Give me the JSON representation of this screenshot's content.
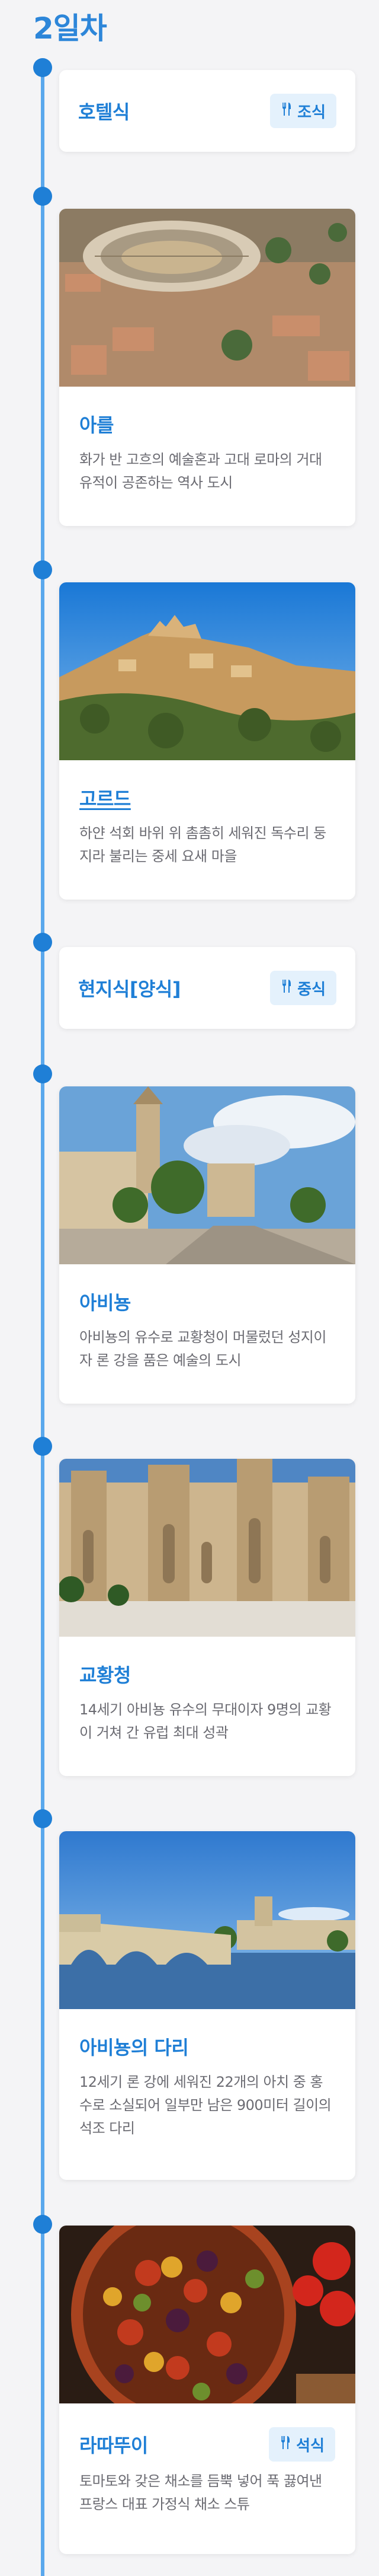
{
  "day": {
    "title": "2일차"
  },
  "items": [
    {
      "title": "호텔식",
      "meal": "조식"
    },
    {
      "title": "아를",
      "desc": "화가 반 고흐의 예술혼과 고대 로마의 거대 유적이 공존하는 역사 도시"
    },
    {
      "title": "고르드",
      "desc": "하얀 석회 바위 위 촘촘히 세워진 독수리 둥지라 불리는 중세 요새 마을"
    },
    {
      "title": "현지식[양식]",
      "meal": "중식"
    },
    {
      "title": "아비뇽",
      "desc": "아비뇽의 유수로 교황청이 머물렀던 성지이자 론 강을 품은 예술의 도시"
    },
    {
      "title": "교황청",
      "desc": "14세기 아비뇽 유수의 무대이자 9명의 교황이 거쳐 간 유럽 최대 성곽"
    },
    {
      "title": "아비뇽의 다리",
      "desc": "12세기 론 강에 세워진 22개의 아치 중 홍수로 소실되어 일부만 남은 900미터 길이의 석조 다리"
    },
    {
      "title": "라따뚜이",
      "meal": "석식",
      "desc": "토마토와 갖은 채소를 듬뿍 넣어 푹 끓여낸 프랑스 대표 가정식 채소 스튜"
    }
  ],
  "icons": {
    "meal": "fork-knife-icon"
  },
  "colors": {
    "accent": "#1f7fd6",
    "tag_bg": "#e4f1fc",
    "line": "#5aa8ec"
  }
}
